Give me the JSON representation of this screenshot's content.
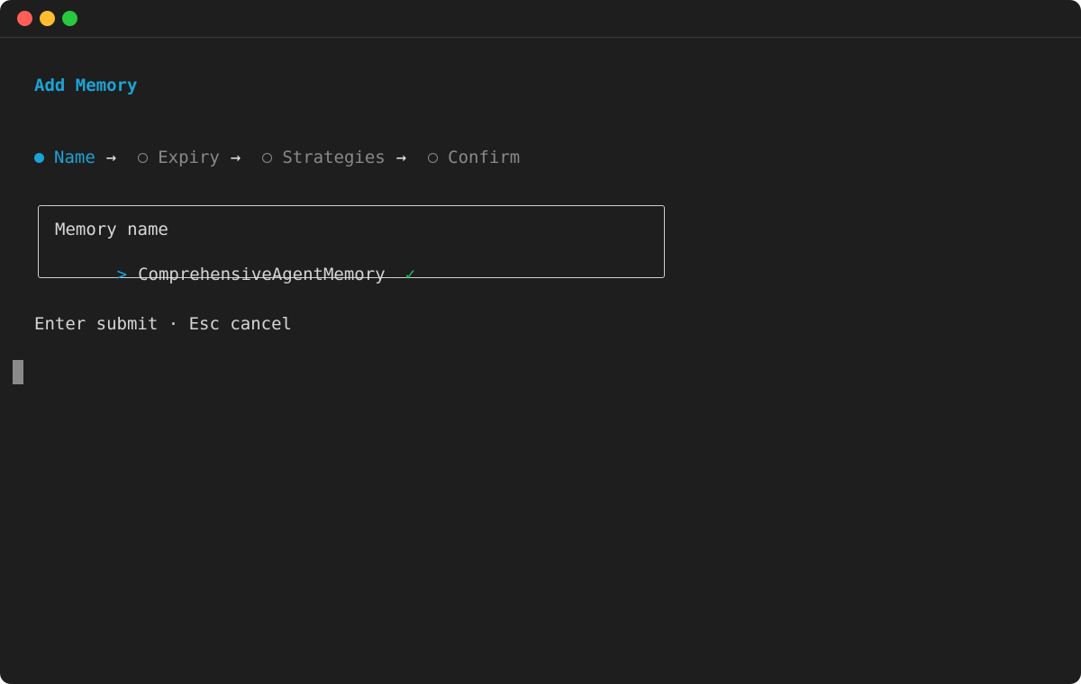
{
  "window": {
    "controls": [
      {
        "name": "close",
        "color": "#ff5f57"
      },
      {
        "name": "minimize",
        "color": "#febc2e"
      },
      {
        "name": "maximize",
        "color": "#28c840"
      }
    ]
  },
  "colors": {
    "accent": "#1ba3d6",
    "muted": "#8a8a8a",
    "success": "#22c55e",
    "text": "#d4d4d4"
  },
  "header": {
    "title": "Add Memory"
  },
  "wizard": {
    "steps": [
      {
        "label": "Name",
        "state": "active"
      },
      {
        "label": "Expiry",
        "state": "pending"
      },
      {
        "label": "Strategies",
        "state": "pending"
      },
      {
        "label": "Confirm",
        "state": "pending"
      }
    ],
    "separator": "→"
  },
  "field": {
    "label": "Memory name",
    "prompt": ">",
    "value": "ComprehensiveAgentMemory",
    "valid_mark": "✓"
  },
  "footer": {
    "hint": "Enter submit · Esc cancel"
  }
}
